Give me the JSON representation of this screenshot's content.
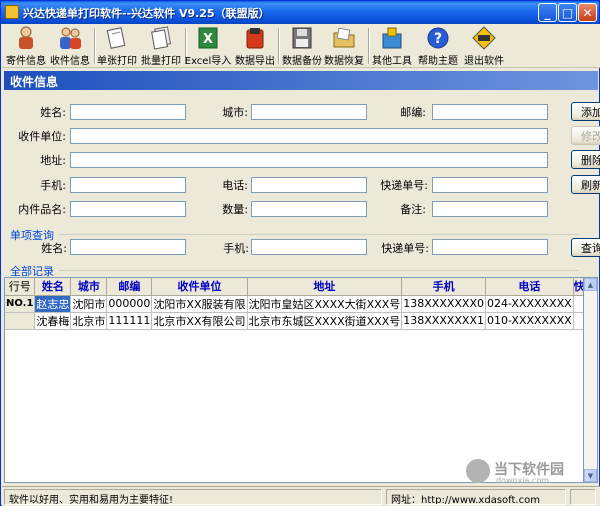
{
  "window": {
    "title": "兴达快递单打印软件--兴达软件 V9.25（联盟版）",
    "min_symbol": "_",
    "max_symbol": "□",
    "close_symbol": "✕"
  },
  "toolbar": {
    "sender_info": "寄件信息",
    "receiver_info": "收件信息",
    "single_print": "单张打印",
    "batch_print": "批量打印",
    "excel_import": "Excel导入",
    "data_export": "数据导出",
    "data_backup": "数据备份",
    "data_restore": "数据恢复",
    "other_tools": "其他工具",
    "help": "帮助主题",
    "exit": "退出软件"
  },
  "section": {
    "title": "收件信息"
  },
  "form": {
    "name_label": "姓名:",
    "city_label": "城市:",
    "zip_label": "邮编:",
    "company_label": "收件单位:",
    "address_label": "地址:",
    "mobile_label": "手机:",
    "phone_label": "电话:",
    "tracking_label": "快递单号:",
    "item_label": "内件品名:",
    "qty_label": "数量:",
    "note_label": "备注:",
    "name": "",
    "city": "",
    "zip": "",
    "company": "",
    "address": "",
    "mobile": "",
    "phone": "",
    "tracking": "",
    "item": "",
    "qty": "",
    "note": ""
  },
  "buttons": {
    "add": "添加",
    "edit": "修改",
    "delete": "删除",
    "refresh": "刷新",
    "query": "查询"
  },
  "query": {
    "group_title": "单项查询",
    "name_label": "姓名:",
    "mobile_label": "手机:",
    "tracking_label": "快递单号:",
    "name": "",
    "mobile": "",
    "tracking": ""
  },
  "records": {
    "group_title": "全部记录",
    "row_header": "行号",
    "columns": [
      "姓名",
      "城市",
      "邮编",
      "收件单位",
      "地址",
      "手机",
      "电话",
      "快递单号"
    ],
    "rows": [
      {
        "no": "NO.1",
        "cells": [
          "赵志忠",
          "沈阳市",
          "000000",
          "沈阳市XX服装有限",
          "沈阳市皇姑区XXXX大街XXX号",
          "138XXXXXXX0",
          "024-XXXXXXXX",
          ""
        ]
      },
      {
        "no": "",
        "cells": [
          "沈春梅",
          "北京市",
          "111111",
          "北京市XX有限公司",
          "北京市东城区XXXX街道XXX号",
          "138XXXXXXX1",
          "010-XXXXXXXX",
          ""
        ]
      }
    ]
  },
  "status": {
    "slogan": "软件以好用、实用和易用为主要特征!",
    "url_label": "网址：http://www.xdasoft.com"
  },
  "watermark": {
    "text": "当下软件园",
    "sub": "downxia.com"
  },
  "colors": {
    "title_bar": "#0a4fd8",
    "section_header": "#1e4fbc",
    "column_header_text": "#0000c0",
    "selection": "#316ac5"
  }
}
